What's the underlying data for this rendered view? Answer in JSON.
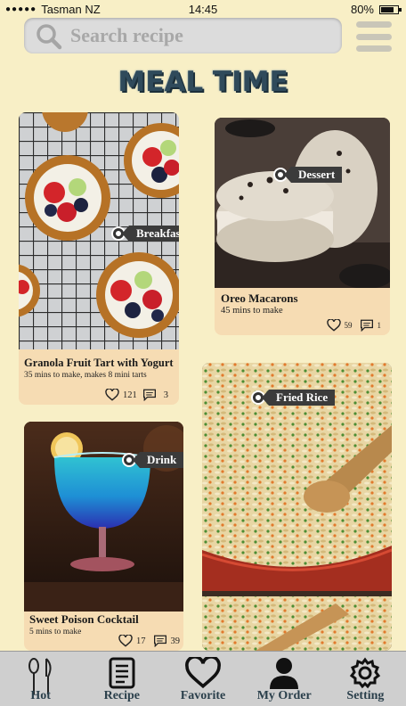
{
  "status_bar": {
    "carrier": "Tasman NZ",
    "time": "14:45",
    "battery": "80%",
    "battery_level": 0.8
  },
  "search": {
    "placeholder": "Search recipe",
    "value": ""
  },
  "app_title": "MEAL TIME",
  "recipes": [
    {
      "name": "Granola Fruit Tart with Yogurt",
      "meta": "35 mins to make, makes 8 mini tarts",
      "likes": "121",
      "comments": "3",
      "tag": "Breakfast"
    },
    {
      "name": "Oreo Macarons",
      "meta": "45 mins to make",
      "likes": "59",
      "comments": "1",
      "tag": "Dessert"
    },
    {
      "name": "Sweet Poison Cocktail",
      "meta": "5 mins to make",
      "likes": "17",
      "comments": "39",
      "tag": "Drink"
    },
    {
      "name": "",
      "meta": "",
      "likes": "",
      "comments": "",
      "tag": "Fried Rice"
    }
  ],
  "tabs": [
    {
      "label": "Hot",
      "icon": "cutlery-icon"
    },
    {
      "label": "Recipe",
      "icon": "recipe-list-icon"
    },
    {
      "label": "Favorite",
      "icon": "heart-icon"
    },
    {
      "label": "My Order",
      "icon": "user-icon"
    },
    {
      "label": "Setting",
      "icon": "gear-icon"
    }
  ],
  "colors": {
    "background": "#f8efc6",
    "card": "#f6dcb3",
    "title": "#2f4a5b",
    "tabbar": "#cfcfcf"
  }
}
